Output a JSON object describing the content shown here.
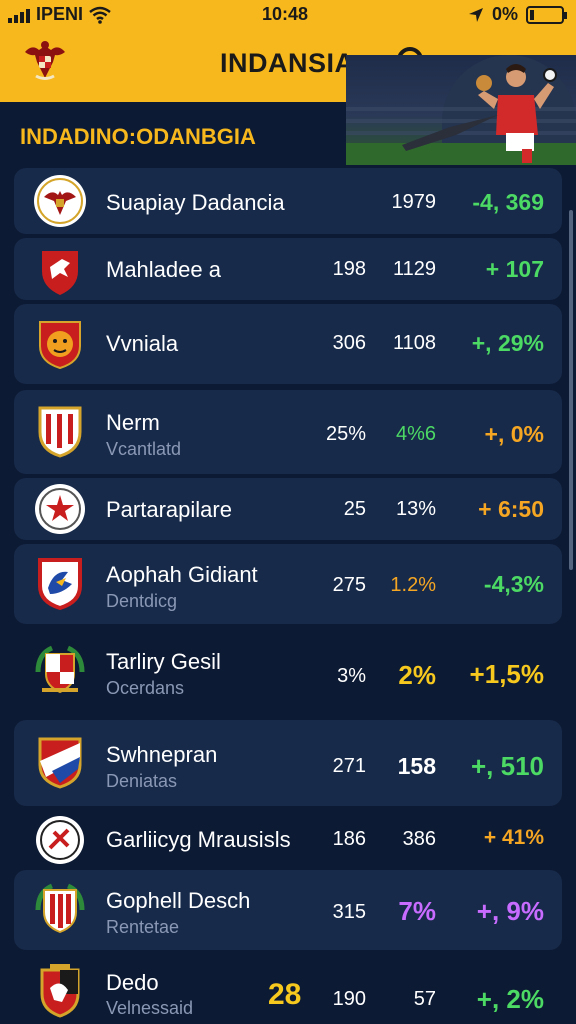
{
  "status_bar": {
    "carrier": "IPENI",
    "time": "10:48",
    "battery": "0%"
  },
  "header": {
    "title": "INDANSIA",
    "logo_icon": "garuda-emblem-icon",
    "search_icon": "search-icon"
  },
  "section": {
    "label": "INDADINO:ODANBGIA"
  },
  "rows": [
    {
      "name": "Suapiay Dadancia",
      "sub": "",
      "c1": "",
      "c2": "1979",
      "c3": "-4, 369",
      "c2_color": "white",
      "c3_color": "green",
      "crest_icon": "garuda-crest-icon"
    },
    {
      "name": "Mahladee a",
      "sub": "",
      "c1": "198",
      "c2": "1129",
      "c3": "+ 107",
      "c2_color": "white",
      "c3_color": "green",
      "crest_icon": "red-shield-crest-icon"
    },
    {
      "name": "Vvniala",
      "sub": "",
      "c1": "306",
      "c2": "1108",
      "c3": "+, 29%",
      "c2_color": "white",
      "c3_color": "green",
      "crest_icon": "tiger-crest-icon"
    },
    {
      "name": "Nerm",
      "sub": "Vcantlatd",
      "c1": "25%",
      "c2": "4%6",
      "c3": "+, 0%",
      "c2_color": "green",
      "c3_color": "orange",
      "crest_icon": "striped-shield-crest-icon"
    },
    {
      "name": "Partarapilare",
      "sub": "",
      "c1": "25",
      "c2": "13%",
      "c3": "+ 6:50",
      "c2_color": "white",
      "c3_color": "orange",
      "crest_icon": "star-round-crest-icon"
    },
    {
      "name": "Aophah Gidiant",
      "sub": "Dentdicg",
      "c1": "275",
      "c2": "1.2%",
      "c3": "-4,3%",
      "c2_color": "orange",
      "c3_color": "green",
      "crest_icon": "eagle-shield-crest-icon"
    },
    {
      "name": "Tarliry Gesil",
      "sub": "Ocerdans",
      "c1": "3%",
      "c2": "2%",
      "c3": "+1,5%",
      "c2_color": "yellow",
      "c3_color": "yellow",
      "crest_icon": "wreath-crest-icon"
    },
    {
      "name": "Swhnepran",
      "sub": "Deniatas",
      "c1": "271",
      "c2": "158",
      "c3": "+, 510",
      "c2_color": "white",
      "c3_color": "green",
      "crest_icon": "diagonal-shield-crest-icon"
    },
    {
      "name": "Garliicyg Mrausisls",
      "sub": "",
      "c1": "186",
      "c2": "386",
      "c3": "+ 41%",
      "c2_color": "white",
      "c3_color": "orange",
      "crest_icon": "round-badge-crest-icon"
    },
    {
      "name": "Gophell Desch",
      "sub": "Rentetae",
      "c1": "315",
      "c2": "7%",
      "c3": "+, 9%",
      "c2_color": "purple",
      "c3_color": "purple",
      "crest_icon": "green-shield-crest-icon"
    },
    {
      "name": "Dedo",
      "sub": "Velnessaid",
      "c0": "28",
      "c1": "190",
      "c2": "57",
      "c3": "+, 2%",
      "c2_color": "white",
      "c3_color": "green",
      "crest_icon": "lion-shield-crest-icon"
    }
  ],
  "colors": {
    "header_bg": "#f7b81d",
    "page_bg": "#0d1a33",
    "card_bg": "#172a4a",
    "positive": "#4cd964",
    "accent": "#f5a623"
  }
}
